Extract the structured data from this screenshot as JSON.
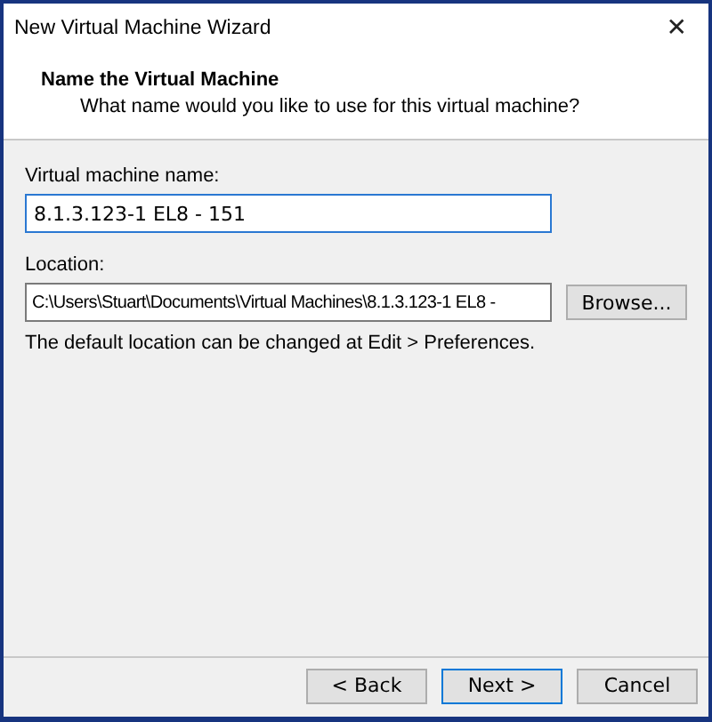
{
  "window": {
    "title": "New Virtual Machine Wizard",
    "close": "✕"
  },
  "header": {
    "title": "Name the Virtual Machine",
    "subtitle": "What name would you like to use for this virtual machine?"
  },
  "name_field": {
    "label": "Virtual machine name:",
    "value": "8.1.3.123-1 EL8 - 151"
  },
  "location_field": {
    "label": "Location:",
    "value": "C:\\Users\\Stuart\\Documents\\Virtual Machines\\8.1.3.123-1 EL8 -"
  },
  "browse_button": "Browse...",
  "note": "The default location can be changed at Edit > Preferences.",
  "buttons": [
    {
      "label": "< Back",
      "default": false
    },
    {
      "label": "Next >",
      "default": true
    },
    {
      "label": "Cancel",
      "default": false
    }
  ]
}
